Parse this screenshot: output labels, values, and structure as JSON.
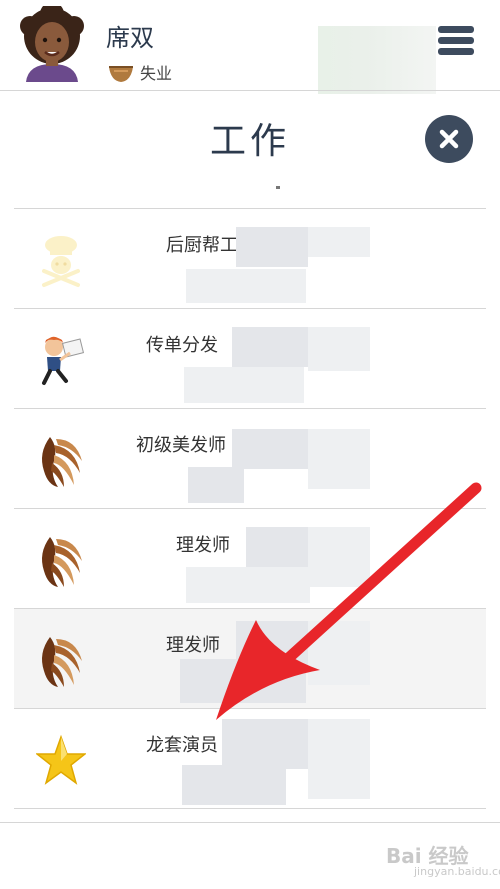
{
  "header": {
    "player_name": "席双",
    "status_text": "失业",
    "status_icon": "bowl-icon"
  },
  "page": {
    "title": "工作"
  },
  "jobs": [
    {
      "name": "后厨帮工",
      "icon": "chef-icon"
    },
    {
      "name": "传单分发",
      "icon": "flyer-runner-icon"
    },
    {
      "name": "初级美发师",
      "icon": "hair-icon"
    },
    {
      "name": "理发师",
      "icon": "hair-icon"
    },
    {
      "name": "理发师",
      "icon": "hair-icon"
    },
    {
      "name": "龙套演员",
      "icon": "star-icon"
    }
  ],
  "watermark": {
    "text": "Bai 经验",
    "sub": "jingyan.baidu.com"
  },
  "colors": {
    "navy": "#3d4b5e",
    "arrow": "#e8262a",
    "divider": "#d6d6d6",
    "star": "#f5c518"
  }
}
